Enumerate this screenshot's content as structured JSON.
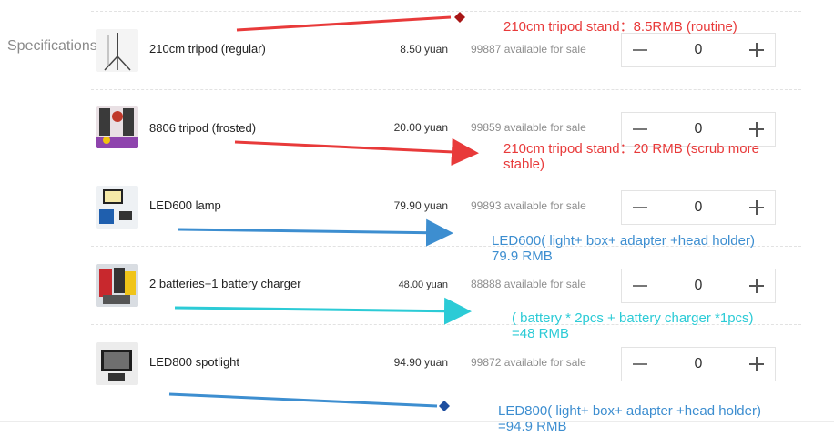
{
  "section_label": "Specifications",
  "items": [
    {
      "name": "210cm tripod (regular)",
      "price": "8.50 yuan",
      "stock": "99887 available for sale",
      "qty": "0"
    },
    {
      "name": "8806 tripod (frosted)",
      "price": "20.00 yuan",
      "stock": "99859 available for sale",
      "qty": "0"
    },
    {
      "name": "LED600 lamp",
      "price": "79.90 yuan",
      "stock": "99893 available for sale",
      "qty": "0"
    },
    {
      "name": "2 batteries+1 battery charger",
      "price": "48.00 yuan",
      "stock": "88888 available for sale",
      "qty": "0"
    },
    {
      "name": "LED800 spotlight",
      "price": "94.90 yuan",
      "stock": "99872 available for sale",
      "qty": "0"
    }
  ],
  "stepper": {
    "minus_icon": "minus-icon",
    "plus_icon": "plus-icon"
  },
  "annotations": [
    {
      "line1": "210cm tripod stand：8.5RMB   (routine)",
      "line2": "",
      "color": "#e83a3a"
    },
    {
      "line1": "210cm tripod stand：20 RMB  (scrub more",
      "line2": "stable)",
      "color": "#e83a3a"
    },
    {
      "line1": "LED600( light+ box+ adapter +head holder)",
      "line2": "79.9 RMB",
      "color": "#3d8ed0"
    },
    {
      "line1": "( battery * 2pcs + battery charger *1pcs)",
      "line2": "=48 RMB",
      "color": "#2ccbd6"
    },
    {
      "line1": "LED800( light+ box+ adapter +head holder)",
      "line2": "=94.9 RMB",
      "color": "#3d8ed0"
    }
  ],
  "colors": {
    "red_arrow": "#e83a3a",
    "blue_arrow": "#3d8ed0",
    "cyan_arrow": "#2ccbd6",
    "blue_diamond": "#1e4fa0",
    "red_diamond": "#a81616"
  }
}
